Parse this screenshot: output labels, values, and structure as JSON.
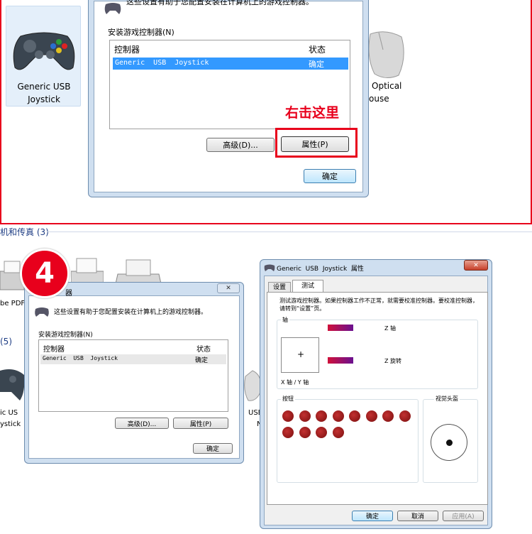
{
  "top": {
    "device1": {
      "line1": "Generic  USB",
      "line2": "Joystick"
    },
    "device2": {
      "line1": "Optical",
      "line2": "ouse"
    },
    "dialog": {
      "intro": "这些设置有助于您配置安装在计算机上的游戏控制器。",
      "group": "安装游戏控制器(N)",
      "col_controller": "控制器",
      "col_status": "状态",
      "row_name": "Generic  USB  Joystick",
      "row_status": "确定",
      "advanced": "高级(D)...",
      "properties": "属性(P)",
      "ok": "确定"
    },
    "annotation": "右击这里"
  },
  "bottom": {
    "section_header": "机和传真 (3)",
    "section_count": "(5)",
    "step_number": "4",
    "left_fragments": {
      "a": "be PDF",
      "b": "ic  US",
      "c": "ystick",
      "usb": "USB",
      "n": "N"
    },
    "dialog": {
      "title_frag": "器",
      "close": "✕",
      "intro": "这些设置有助于您配置安装在计算机上的游戏控制器。",
      "group": "安装游戏控制器(N)",
      "col_controller": "控制器",
      "col_status": "状态",
      "row_name": "Generic  USB  Joystick",
      "row_status": "确定",
      "advanced": "高级(D)...",
      "properties": "属性(P)",
      "ok": "确定"
    },
    "props": {
      "title": "Generic  USB  Joystick  属性",
      "tab_settings": "设置",
      "tab_test": "测试",
      "desc": "测试游戏控制器。如果控制器工作不正常，就需要校准控制器。要校准控制器，请转到“设置”页。",
      "axes_label": "轴",
      "z_axis": "Z 轴",
      "z_rot": "Z 旋转",
      "xy_axis": "X 轴 / Y 轴",
      "buttons_label": "按钮",
      "pov_label": "视觉头盔",
      "ok": "确定",
      "cancel": "取消",
      "apply": "应用(A)"
    }
  },
  "colors": {
    "accent_red": "#e8001c",
    "select_blue": "#3399ff",
    "button_red": "#a01515"
  }
}
